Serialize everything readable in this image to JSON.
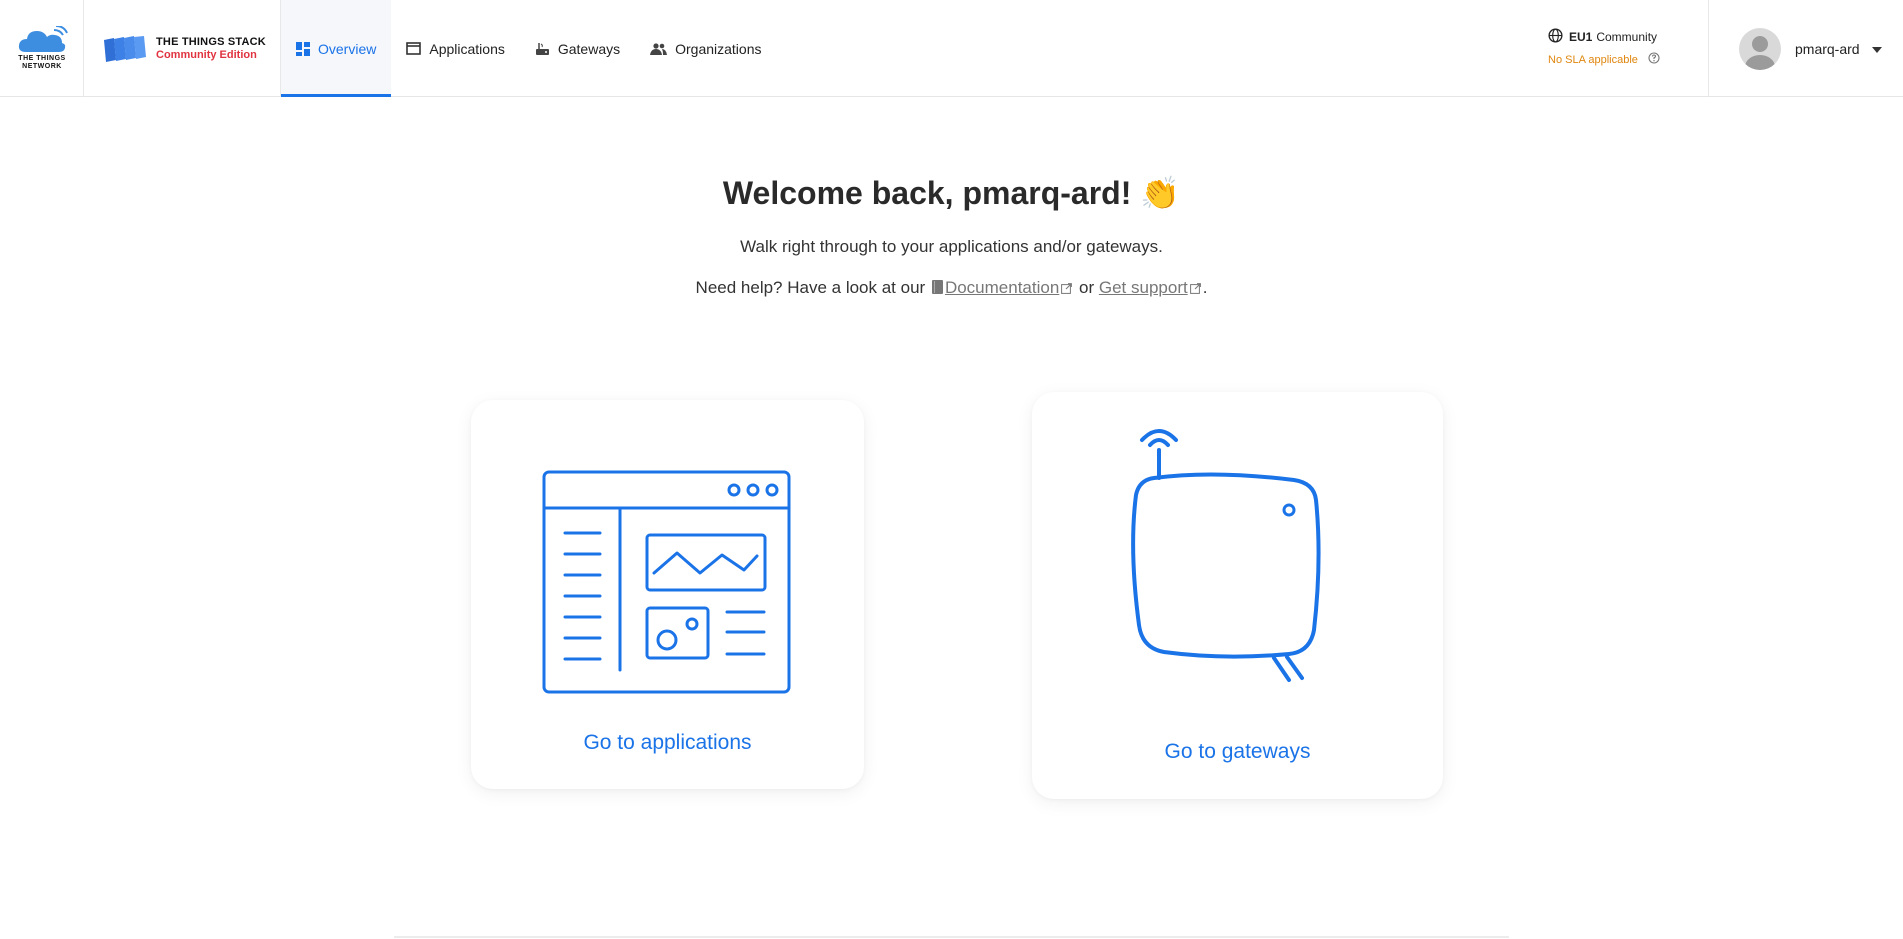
{
  "logos": {
    "ttn_line1": "THE THINGS",
    "ttn_line2": "NETWORK",
    "stack_name": "THE THINGS STACK",
    "stack_edition": "Community Edition"
  },
  "nav": {
    "overview": "Overview",
    "applications": "Applications",
    "gateways": "Gateways",
    "organizations": "Organizations"
  },
  "cluster": {
    "region": "EU1",
    "tier": "Community",
    "sla": "No SLA applicable"
  },
  "user": {
    "name": "pmarq-ard"
  },
  "main": {
    "welcome": "Welcome back, pmarq-ard!",
    "emoji": "👏",
    "subtitle": "Walk right through to your applications and/or gateways.",
    "help_prefix": "Need help? Have a look at our",
    "doc_link": "Documentation",
    "or_text": "or",
    "support_link": "Get support",
    "period": "."
  },
  "cards": {
    "applications_label": "Go to applications",
    "gateways_label": "Go to gateways"
  },
  "colors": {
    "accent": "#1b73e8",
    "edition": "#e0333f",
    "sla": "#e0860e"
  },
  "icons": [
    "ttn-cloud-icon",
    "stack-logo-icon",
    "overview-icon",
    "applications-icon",
    "gateway-icon",
    "organizations-icon",
    "globe-icon",
    "help-circle-icon",
    "avatar-icon",
    "caret-down-icon",
    "book-icon",
    "external-link-icon",
    "application-illustration",
    "gateway-illustration"
  ]
}
